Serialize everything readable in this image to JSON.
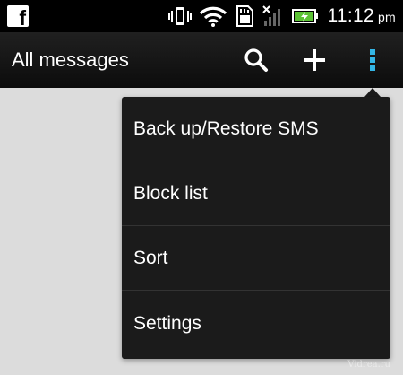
{
  "status_bar": {
    "time": "11:12",
    "ampm": "pm",
    "icons": [
      "facebook-notification-icon",
      "vibrate-icon",
      "wifi-icon",
      "sd-card-icon",
      "signal-no-service-icon",
      "battery-charging-icon"
    ]
  },
  "action_bar": {
    "title": "All messages",
    "icons": [
      "search-icon",
      "plus-icon",
      "overflow-menu-icon"
    ]
  },
  "menu": {
    "items": [
      {
        "label": "Back up/Restore SMS"
      },
      {
        "label": "Block list"
      },
      {
        "label": "Sort"
      },
      {
        "label": "Settings"
      }
    ]
  },
  "watermark": "Vidrea.ru",
  "colors": {
    "status_bar_bg": "#000000",
    "action_bar_bg": "#161616",
    "menu_bg": "#1b1b1b",
    "content_bg": "#dcdcdc",
    "overflow_accent": "#33b5e5",
    "battery_green": "#5cc335"
  }
}
